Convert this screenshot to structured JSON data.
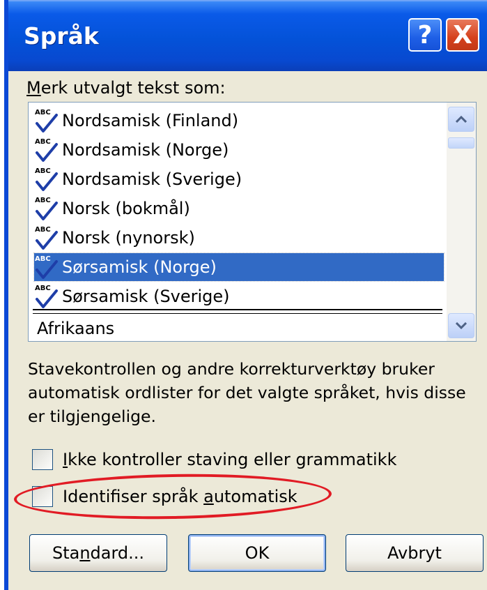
{
  "window": {
    "title": "Språk",
    "help_glyph": "?",
    "close_glyph": "X"
  },
  "list": {
    "label_prefix": "M",
    "label_rest": "erk utvalgt tekst som:",
    "items": [
      {
        "label": "Nordsamisk (Finland)",
        "icon": "abc-spellcheck-icon"
      },
      {
        "label": "Nordsamisk (Norge)",
        "icon": "abc-spellcheck-icon"
      },
      {
        "label": "Nordsamisk (Sverige)",
        "icon": "abc-spellcheck-icon"
      },
      {
        "label": "Norsk (bokmål)",
        "icon": "abc-spellcheck-icon"
      },
      {
        "label": "Norsk (nynorsk)",
        "icon": "abc-spellcheck-icon"
      },
      {
        "label": "Sørsamisk (Norge)",
        "icon": "abc-spellcheck-icon",
        "selected": true
      },
      {
        "label": "Sørsamisk (Sverige)",
        "icon": "abc-spellcheck-icon"
      }
    ],
    "plain_item": "Afrikaans"
  },
  "description": "Stavekontrollen og andre korrekturverktøy bruker automatisk ordlister for det valgte språket, hvis disse er tilgjengelige.",
  "checkboxes": {
    "no_check_u": "I",
    "no_check_rest": "kke kontroller staving eller grammatikk",
    "detect_pre": "Identifiser språk ",
    "detect_u": "a",
    "detect_rest": "utomatisk"
  },
  "buttons": {
    "standard_pre": "Sta",
    "standard_u": "n",
    "standard_rest": "dard...",
    "ok": "OK",
    "cancel": "Avbryt"
  },
  "colors": {
    "selection": "#316ac5",
    "annotation": "#e11b24",
    "titlebar": "#0452d8"
  }
}
